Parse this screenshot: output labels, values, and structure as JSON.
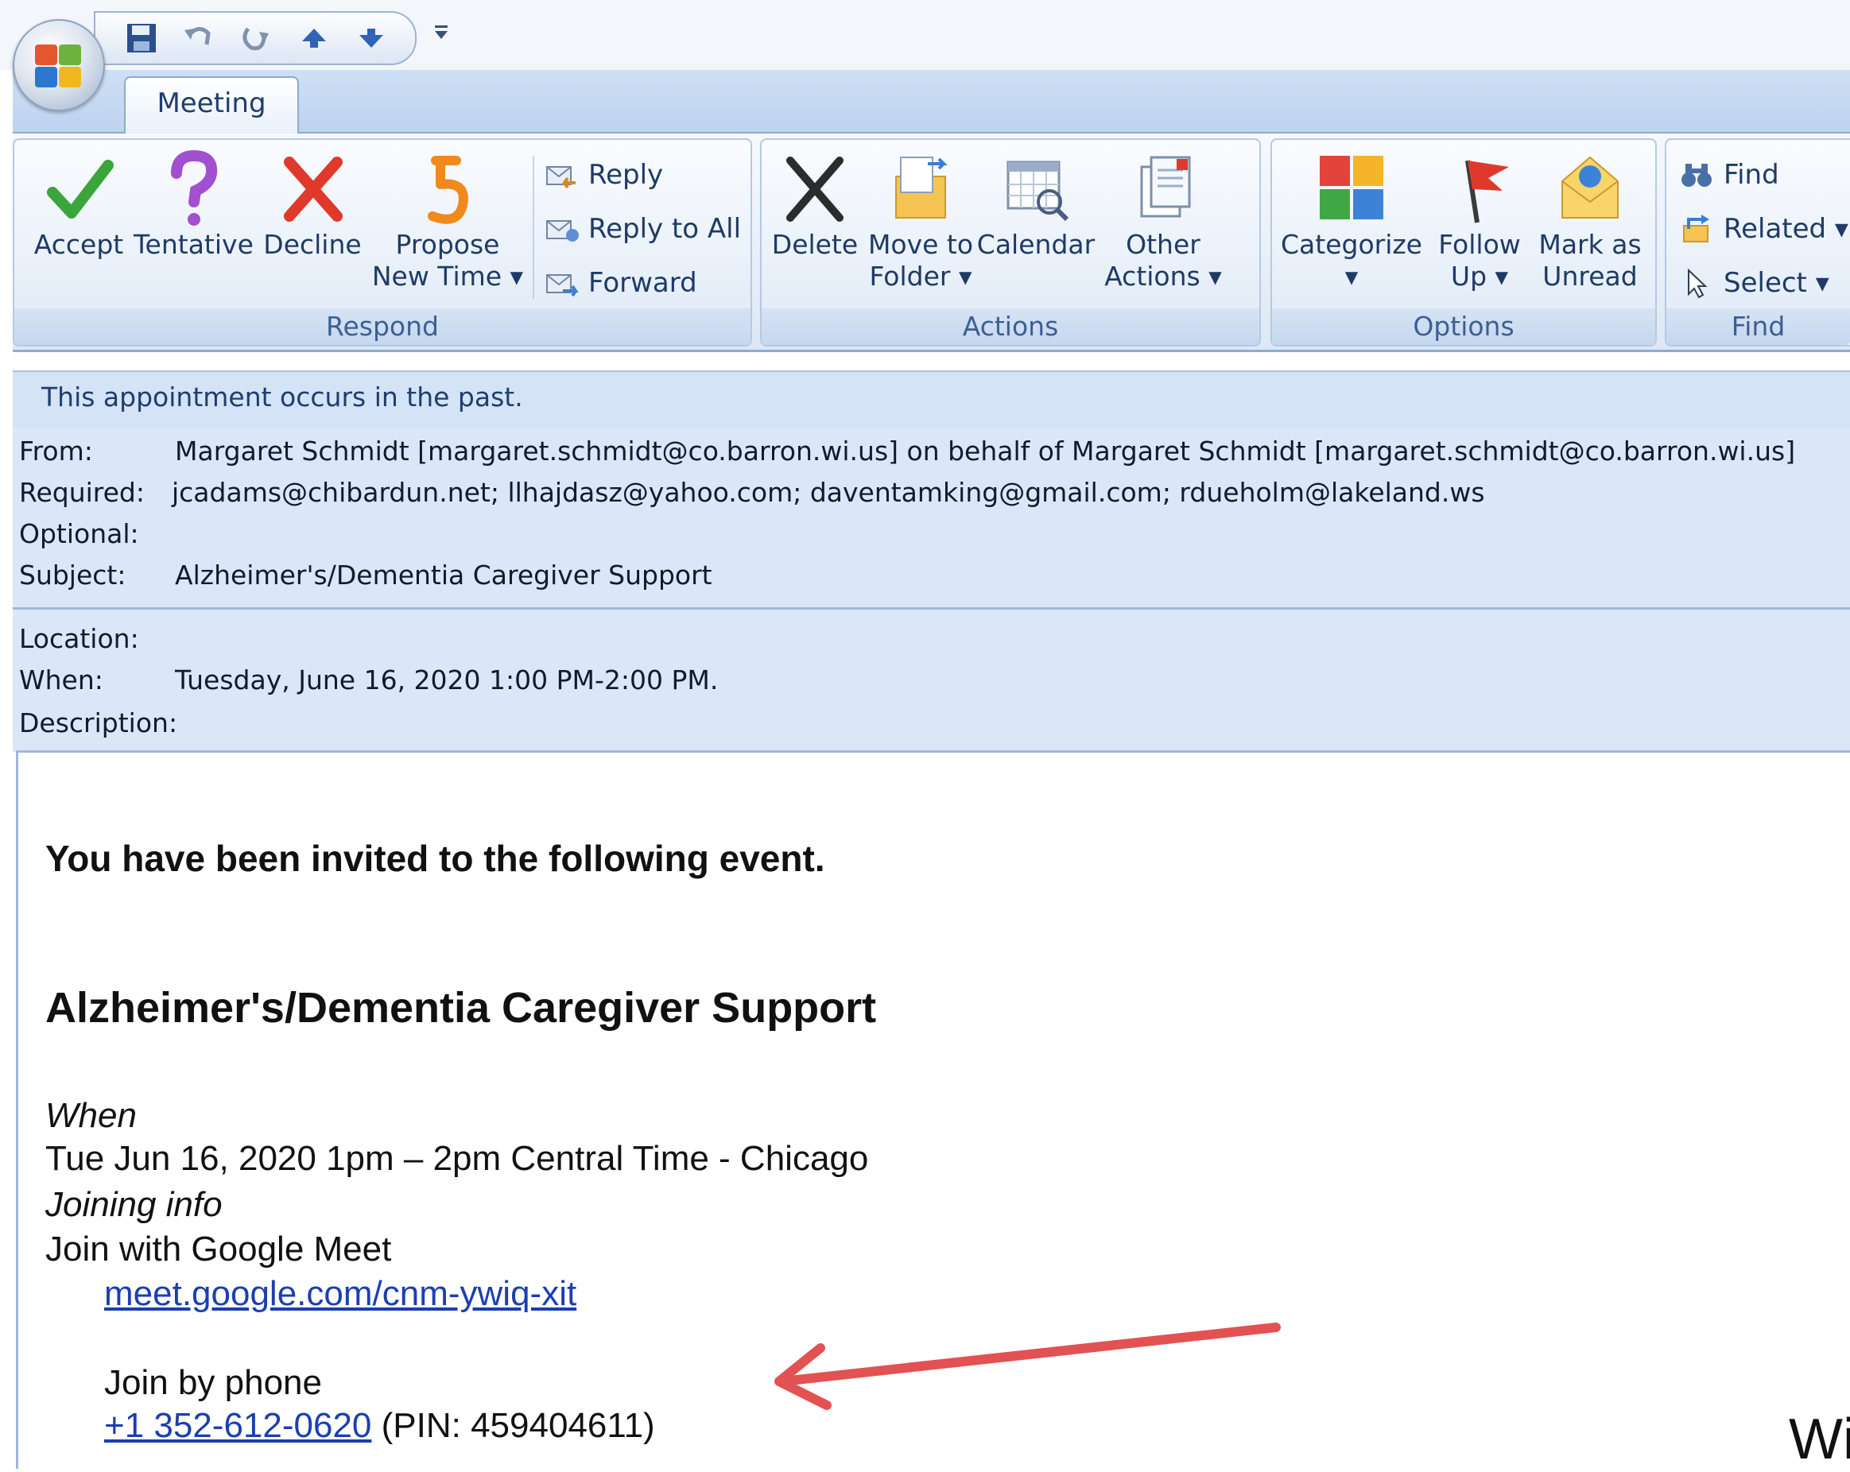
{
  "window": {
    "tab": "Meeting"
  },
  "ribbon": {
    "respond": {
      "label": "Respond",
      "accept": "Accept",
      "tentative": "Tentative",
      "decline": "Decline",
      "propose_line1": "Propose",
      "propose_line2": "New Time ▾",
      "reply": "Reply",
      "reply_all": "Reply to All",
      "forward": "Forward"
    },
    "actions": {
      "label": "Actions",
      "delete": "Delete",
      "move_line1": "Move to",
      "move_line2": "Folder ▾",
      "calendar": "Calendar",
      "other_line1": "Other",
      "other_line2": "Actions ▾"
    },
    "options": {
      "label": "Options",
      "categorize_line1": "Categorize",
      "categorize_line2": "▾",
      "follow_line1": "Follow",
      "follow_line2": "Up ▾",
      "mark_line1": "Mark as",
      "mark_line2": "Unread"
    },
    "find": {
      "label": "Find",
      "find": "Find",
      "related": "Related ▾",
      "select": "Select ▾"
    }
  },
  "infobar": "This appointment occurs in the past.",
  "header": {
    "from_label": "From:",
    "from_value": "Margaret Schmidt [margaret.schmidt@co.barron.wi.us] on behalf of Margaret Schmidt [margaret.schmidt@co.barron.wi.us]",
    "required_label": "Required:",
    "required_value": "jcadams@chibardun.net; llhajdasz@yahoo.com; daventamking@gmail.com; rdueholm@lakeland.ws",
    "optional_label": "Optional:",
    "optional_value": "",
    "subject_label": "Subject:",
    "subject_value": "Alzheimer's/Dementia Caregiver Support",
    "location_label": "Location:",
    "location_value": "",
    "when_label": "When:",
    "when_value": "Tuesday, June 16, 2020 1:00 PM-2:00 PM.",
    "description_label": "Description:"
  },
  "body": {
    "invite": "You have been invited to the following event.",
    "event_title": "Alzheimer's/Dementia Caregiver Support",
    "when_heading": "When",
    "when_text": "Tue Jun 16, 2020 1pm – 2pm Central Time - Chicago",
    "joining_heading": "Joining info",
    "join_meet": "Join with Google Meet",
    "meet_link": "meet.google.com/cnm-ywiq-xit",
    "join_phone": "Join by phone",
    "phone_link": "+1 352-612-0620",
    "pin": "(PIN: 459404611)"
  },
  "annotation": {
    "color": "#e25252"
  },
  "watermark": "Wi"
}
